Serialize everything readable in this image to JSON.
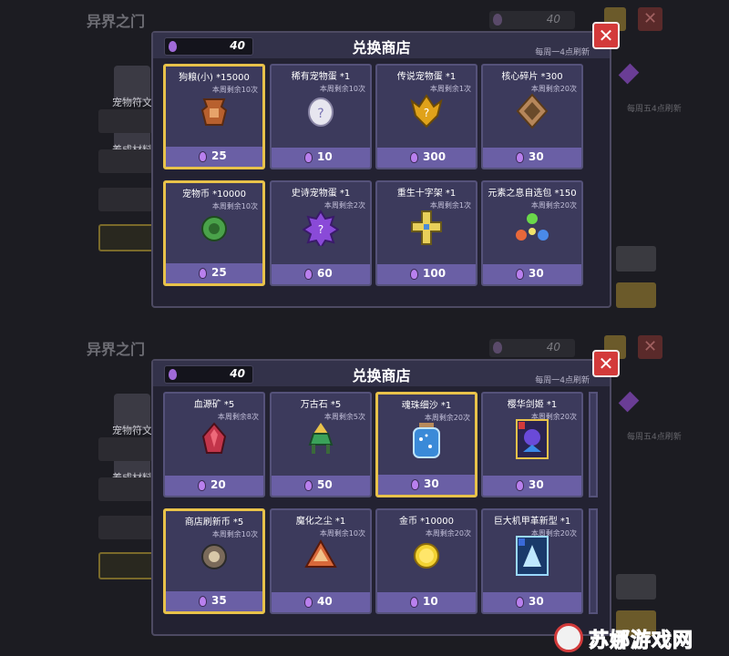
{
  "background": {
    "title": "异界之门",
    "currency_value": "40",
    "side_items": [
      "宠物符文",
      "养成材料"
    ],
    "right_note": "每周五4点刷新"
  },
  "panel1": {
    "title": "兑换商店",
    "currency": "40",
    "refresh_note": "每周一4点刷新",
    "items": [
      {
        "name": "狗粮(小) *15000",
        "remain": "本周剩余10次",
        "icon": "meat-icon",
        "price": "25",
        "selected": true
      },
      {
        "name": "稀有宠物蛋 *1",
        "remain": "本周剩余10次",
        "icon": "rare-egg-icon",
        "price": "10",
        "selected": false
      },
      {
        "name": "传说宠物蛋 *1",
        "remain": "本周剩余1次",
        "icon": "legend-egg-icon",
        "price": "300",
        "selected": false
      },
      {
        "name": "核心碎片 *300",
        "remain": "本周剩余20次",
        "icon": "core-fragment-icon",
        "price": "30",
        "selected": false
      },
      {
        "name": "宠物币 *10000",
        "remain": "本周剩余10次",
        "icon": "pet-coin-icon",
        "price": "25",
        "selected": true
      },
      {
        "name": "史诗宠物蛋 *1",
        "remain": "本周剩余2次",
        "icon": "epic-egg-icon",
        "price": "60",
        "selected": false
      },
      {
        "name": "重生十字架 *1",
        "remain": "本周剩余1次",
        "icon": "cross-icon",
        "price": "100",
        "selected": false
      },
      {
        "name": "元素之息自选包 *150",
        "remain": "本周剩余20次",
        "icon": "element-orbs-icon",
        "price": "30",
        "selected": false
      }
    ]
  },
  "panel2": {
    "title": "兑换商店",
    "currency": "40",
    "refresh_note": "每周一4点刷新",
    "items": [
      {
        "name": "血源矿 *5",
        "remain": "本周剩余8次",
        "icon": "blood-ore-icon",
        "price": "20",
        "selected": false
      },
      {
        "name": "万古石 *5",
        "remain": "本周剩余5次",
        "icon": "ancient-stone-icon",
        "price": "50",
        "selected": false
      },
      {
        "name": "魂珠细沙 *1",
        "remain": "本周剩余20次",
        "icon": "sand-jar-icon",
        "price": "30",
        "selected": true
      },
      {
        "name": "樱华剑姬 *1",
        "remain": "本周剩余20次",
        "icon": "card-character-icon",
        "price": "30",
        "selected": false
      },
      {
        "name": "商店刷新币 *5",
        "remain": "本周剩余10次",
        "icon": "refresh-coin-icon",
        "price": "35",
        "selected": true
      },
      {
        "name": "魔化之尘 *1",
        "remain": "本周剩余10次",
        "icon": "dust-pile-icon",
        "price": "40",
        "selected": false
      },
      {
        "name": "金币 *10000",
        "remain": "本周剩余20次",
        "icon": "gold-coin-icon",
        "price": "10",
        "selected": false
      },
      {
        "name": "巨大机甲革新型 *1",
        "remain": "本周剩余20次",
        "icon": "mech-card-icon",
        "price": "30",
        "selected": false
      }
    ]
  },
  "watermark": "苏娜游戏网",
  "colors": {
    "accent_gold": "#e8c24a",
    "price_bar": "#6a5fa5",
    "close_red": "#d33a3a"
  }
}
